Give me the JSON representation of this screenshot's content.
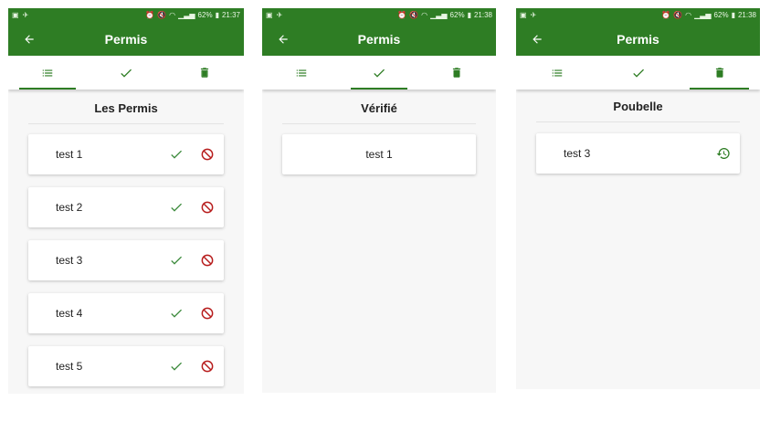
{
  "colors": {
    "primary": "#2e7d24",
    "check": "#3b8a3b",
    "ban": "#b71c1c",
    "restore": "#2e7d24"
  },
  "statusbar": {
    "battery": "62%"
  },
  "screens": [
    {
      "time": "21:37",
      "title": "Permis",
      "active_tab": 0,
      "section_title": "Les Permis",
      "items": [
        {
          "label": "test 1"
        },
        {
          "label": "test 2"
        },
        {
          "label": "test 3"
        },
        {
          "label": "test 4"
        },
        {
          "label": "test 5"
        }
      ]
    },
    {
      "time": "21:38",
      "title": "Permis",
      "active_tab": 1,
      "section_title": "Vérifié",
      "items": [
        {
          "label": "test 1"
        }
      ]
    },
    {
      "time": "21:38",
      "title": "Permis",
      "active_tab": 2,
      "section_title": "Poubelle",
      "items": [
        {
          "label": "test 3"
        }
      ]
    }
  ],
  "icons": {
    "tabs": [
      "list-icon",
      "check-icon",
      "trash-icon"
    ]
  }
}
